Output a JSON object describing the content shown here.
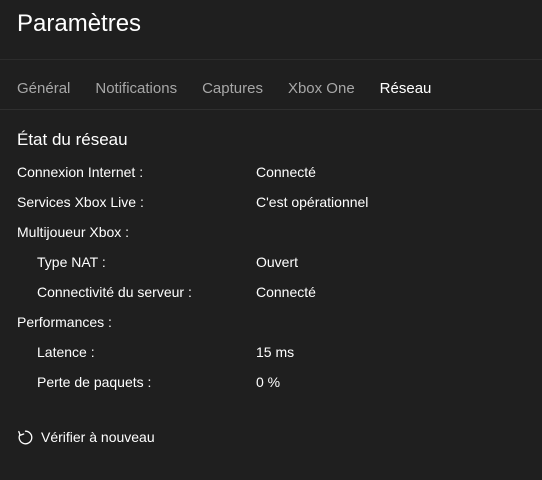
{
  "window": {
    "title": "Paramètres"
  },
  "tabs": [
    {
      "label": "Général",
      "active": false
    },
    {
      "label": "Notifications",
      "active": false
    },
    {
      "label": "Captures",
      "active": false
    },
    {
      "label": "Xbox One",
      "active": false
    },
    {
      "label": "Réseau",
      "active": true
    }
  ],
  "network": {
    "section_title": "État du réseau",
    "rows": [
      {
        "label": "Connexion Internet :",
        "value": "Connecté"
      },
      {
        "label": "Services Xbox Live :",
        "value": "C'est opérationnel"
      },
      {
        "label": "Multijoueur Xbox :",
        "value": ""
      },
      {
        "label": "Type NAT :",
        "value": "Ouvert"
      },
      {
        "label": "Connectivité du serveur :",
        "value": "Connecté"
      },
      {
        "label": "Performances :",
        "value": ""
      },
      {
        "label": "Latence :",
        "value": "15 ms"
      },
      {
        "label": "Perte de paquets :",
        "value": "0 %"
      }
    ]
  },
  "actions": {
    "retry_label": "Vérifier à nouveau",
    "retry_icon": "refresh-icon"
  },
  "colors": {
    "background": "#1f1f1f",
    "text": "#ffffff",
    "inactive_tab": "#a7a7a7",
    "divider": "#2f2f2f"
  }
}
